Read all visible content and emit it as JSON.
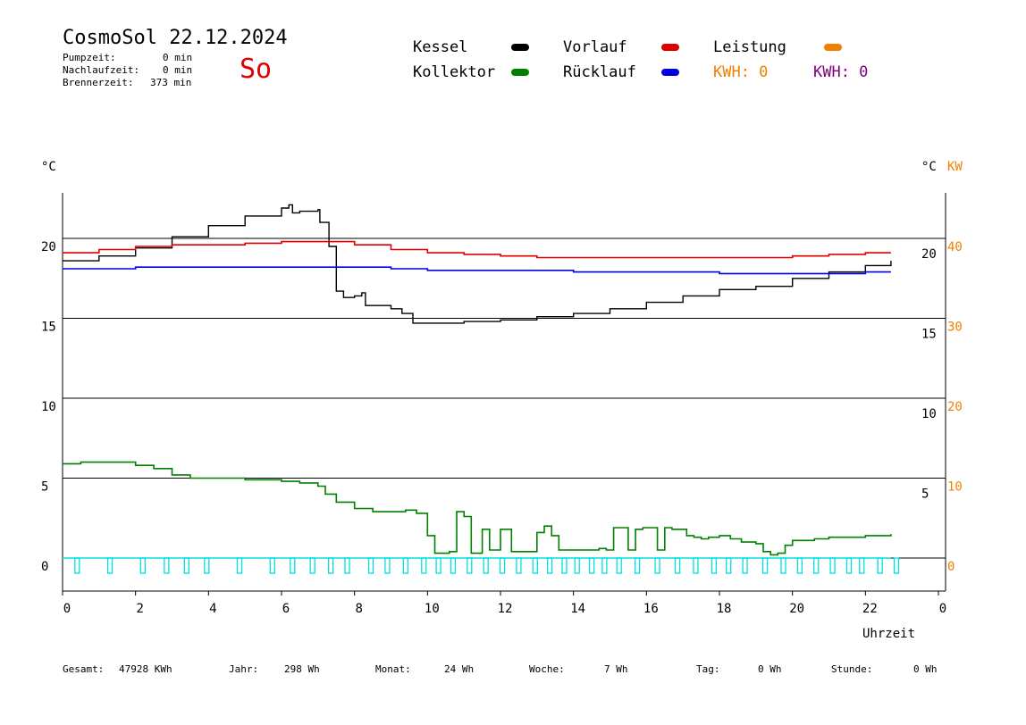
{
  "header": {
    "title": "CosmoSol 22.12.2024",
    "day": "So",
    "pumpzeit_label": "Pumpzeit:",
    "pumpzeit_value": "0 min",
    "nachlaufzeit_label": "Nachlaufzeit:",
    "nachlaufzeit_value": "0 min",
    "brennerzeit_label": "Brennerzeit:",
    "brennerzeit_value": "373 min"
  },
  "legend": {
    "kessel": "Kessel",
    "vorlauf": "Vorlauf",
    "leistung": "Leistung",
    "kollektor": "Kollektor",
    "ruecklauf": "Rücklauf",
    "kwh1": "KWH: 0",
    "kwh2": "KWH: 0"
  },
  "colors": {
    "kessel": "#000000",
    "vorlauf": "#e00000",
    "leistung": "#f08000",
    "kollektor": "#008000",
    "ruecklauf": "#0000e0",
    "pump": "#00e0e0",
    "kwh2": "#800080"
  },
  "footer": {
    "gesamt_label": "Gesamt:",
    "gesamt_value": "47928 KWh",
    "jahr_label": "Jahr:",
    "jahr_value": "298 Wh",
    "monat_label": "Monat:",
    "monat_value": "24 Wh",
    "woche_label": "Woche:",
    "woche_value": "7 Wh",
    "tag_label": "Tag:",
    "tag_value": "0 Wh",
    "stunde_label": "Stunde:",
    "stunde_value": "0 Wh"
  },
  "chart_data": {
    "type": "line",
    "xlabel": "Uhrzeit",
    "ylabel_left": "°C",
    "ylabel_right": "°C",
    "ylabel_right2": "KW",
    "xlim": [
      0,
      24
    ],
    "ylim": [
      -2,
      23
    ],
    "grid": true,
    "x_ticks": [
      "0",
      "2",
      "4",
      "6",
      "8",
      "10",
      "12",
      "14",
      "16",
      "18",
      "20",
      "22",
      "0"
    ],
    "y_left_ticks": [
      "0",
      "5",
      "10",
      "15",
      "20"
    ],
    "y_right_ticks": [
      "5",
      "10",
      "15",
      "20"
    ],
    "y_right2_ticks": [
      "0",
      "10",
      "20",
      "30",
      "40"
    ],
    "series": [
      {
        "name": "Kessel",
        "color": "#000000",
        "x": [
          0,
          1,
          2,
          3,
          4,
          5,
          6,
          6.2,
          6.3,
          6.5,
          7,
          7.05,
          7.3,
          7.5,
          7.7,
          8,
          8.2,
          8.3,
          9,
          9.3,
          9.6,
          10,
          11,
          12,
          13,
          14,
          15,
          16,
          17,
          18,
          18.5,
          19,
          20,
          21,
          22,
          22.7
        ],
        "y": [
          18.6,
          18.9,
          19.4,
          20.1,
          20.8,
          21.4,
          21.9,
          22.1,
          21.6,
          21.7,
          21.8,
          21.0,
          19.5,
          16.7,
          16.3,
          16.4,
          16.6,
          15.8,
          15.6,
          15.3,
          14.7,
          14.7,
          14.8,
          14.9,
          15.1,
          15.3,
          15.6,
          16.0,
          16.4,
          16.8,
          16.8,
          17.0,
          17.5,
          17.9,
          18.3,
          18.6
        ]
      },
      {
        "name": "Vorlauf",
        "color": "#e00000",
        "x": [
          0,
          1,
          2,
          3,
          4,
          5,
          6,
          7,
          7.5,
          8,
          9,
          10,
          11,
          12,
          13,
          14,
          15,
          16,
          17,
          18,
          19,
          20,
          21,
          22,
          22.7
        ],
        "y": [
          19.1,
          19.3,
          19.5,
          19.6,
          19.6,
          19.7,
          19.8,
          19.8,
          19.8,
          19.6,
          19.3,
          19.1,
          19.0,
          18.9,
          18.8,
          18.8,
          18.8,
          18.8,
          18.8,
          18.8,
          18.8,
          18.9,
          19.0,
          19.1,
          19.1
        ]
      },
      {
        "name": "Rücklauf",
        "color": "#0000e0",
        "x": [
          0,
          2,
          4,
          6,
          7,
          8,
          9,
          10,
          11,
          12,
          13,
          14,
          16,
          18,
          20,
          22,
          22.7
        ],
        "y": [
          18.1,
          18.2,
          18.2,
          18.2,
          18.2,
          18.2,
          18.1,
          18.0,
          18.0,
          18.0,
          18.0,
          17.9,
          17.9,
          17.8,
          17.8,
          17.9,
          17.9
        ]
      },
      {
        "name": "Kollektor",
        "color": "#008000",
        "x": [
          0,
          0.5,
          1,
          2,
          2.5,
          3,
          3.5,
          4,
          5,
          6,
          6.5,
          7,
          7.2,
          7.5,
          8,
          8.5,
          9,
          9.4,
          9.7,
          10,
          10.2,
          10.4,
          10.6,
          10.8,
          11,
          11.2,
          11.5,
          11.7,
          12,
          12.3,
          12.6,
          13,
          13.2,
          13.4,
          13.6,
          14,
          14.4,
          14.7,
          14.9,
          15.1,
          15.3,
          15.5,
          15.7,
          15.9,
          16.1,
          16.3,
          16.5,
          16.7,
          16.9,
          17.1,
          17.3,
          17.5,
          17.7,
          18,
          18.3,
          18.6,
          19,
          19.2,
          19.4,
          19.6,
          19.8,
          20,
          20.3,
          20.6,
          21,
          21.3,
          21.6,
          22,
          22.3,
          22.7
        ],
        "y": [
          5.9,
          6.0,
          6.0,
          5.8,
          5.6,
          5.2,
          5.0,
          5.0,
          4.9,
          4.8,
          4.7,
          4.5,
          4.0,
          3.5,
          3.1,
          2.9,
          2.9,
          3.0,
          2.8,
          1.4,
          0.3,
          0.3,
          0.4,
          2.9,
          2.6,
          0.3,
          1.8,
          0.5,
          1.8,
          0.4,
          0.4,
          1.6,
          2.0,
          1.4,
          0.5,
          0.5,
          0.5,
          0.6,
          0.5,
          1.9,
          1.9,
          0.5,
          1.8,
          1.9,
          1.9,
          0.5,
          1.9,
          1.8,
          1.8,
          1.4,
          1.3,
          1.2,
          1.3,
          1.4,
          1.2,
          1.0,
          0.9,
          0.4,
          0.2,
          0.3,
          0.8,
          1.1,
          1.1,
          1.2,
          1.3,
          1.3,
          1.3,
          1.4,
          1.4,
          1.5
        ]
      }
    ],
    "pump_pulses_x": [
      0.4,
      1.3,
      2.2,
      2.85,
      3.4,
      3.95,
      4.85,
      5.75,
      6.3,
      6.85,
      7.35,
      7.8,
      8.45,
      8.9,
      9.4,
      9.9,
      10.3,
      10.7,
      11.15,
      11.6,
      12.05,
      12.5,
      12.95,
      13.35,
      13.75,
      14.1,
      14.5,
      14.85,
      15.25,
      15.75,
      16.3,
      16.85,
      17.35,
      17.85,
      18.25,
      18.7,
      19.25,
      19.75,
      20.2,
      20.65,
      21.1,
      21.55,
      21.9,
      22.4,
      22.85
    ]
  }
}
